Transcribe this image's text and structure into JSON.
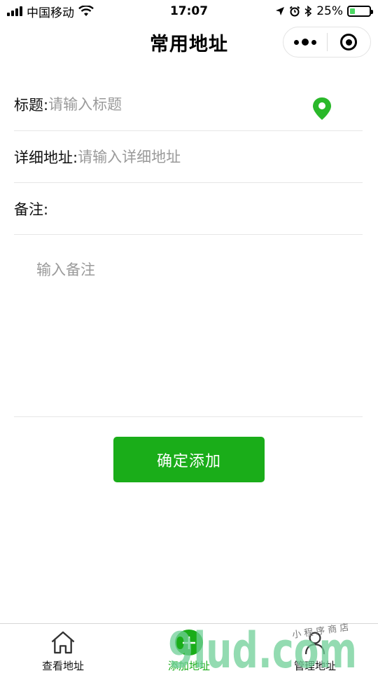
{
  "status_bar": {
    "carrier": "中国移动",
    "time": "17:07",
    "battery": "25%",
    "battery_level": 0.25
  },
  "nav": {
    "title": "常用地址"
  },
  "form": {
    "title_label": "标题:",
    "title_placeholder": "请输入标题",
    "detail_label": "详细地址:",
    "detail_placeholder": "请输入详细地址",
    "note_label": "备注:",
    "note_placeholder": "输入备注"
  },
  "confirm_button": "确定添加",
  "tabs": [
    {
      "label": "查看地址",
      "icon": "home-icon",
      "active": false
    },
    {
      "label": "添加地址",
      "icon": "add-circle-icon",
      "active": true
    },
    {
      "label": "管理地址",
      "icon": "user-icon",
      "active": false
    }
  ],
  "watermark": {
    "text": "9lud.com",
    "subtext": "小 程 序 商 店"
  },
  "colors": {
    "accent": "#1aad19",
    "pin": "#2ab82a",
    "placeholder": "#9a9a9a"
  }
}
